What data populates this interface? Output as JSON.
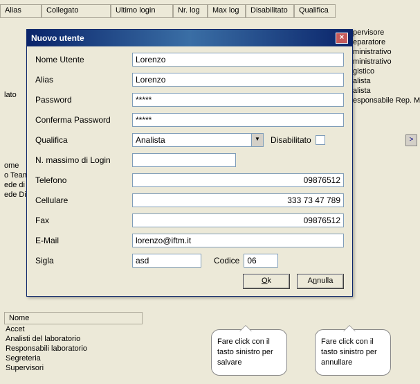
{
  "bg": {
    "headers": [
      "Alias",
      "Collegato",
      "Ultimo login",
      "Nr. log",
      "Max log",
      "Disabilitato",
      "Qualifica"
    ],
    "rightList": [
      "pervisore",
      "eparatore",
      "ministrativo",
      "ministrativo",
      "gistico",
      "alista",
      "alista",
      "esponsabile Rep. M"
    ],
    "leftList": [
      "lato",
      "ome",
      "o Team",
      "ede di R",
      "ede Dista"
    ],
    "bottomHeader": "Nome",
    "bottomList": [
      "Accet",
      "Analisti del laboratorio",
      "Responsabili laboratorio",
      "Segreteria",
      "Supervisori"
    ]
  },
  "dialog": {
    "title": "Nuovo utente",
    "labels": {
      "nome": "Nome Utente",
      "alias": "Alias",
      "password": "Password",
      "conferma": "Conferma Password",
      "qualifica": "Qualifica",
      "disabilitato": "Disabilitato",
      "maxlogin": "N. massimo di Login",
      "telefono": "Telefono",
      "cellulare": "Cellulare",
      "fax": "Fax",
      "email": "E-Mail",
      "sigla": "Sigla",
      "codice": "Codice"
    },
    "values": {
      "nome": "Lorenzo",
      "alias": "Lorenzo",
      "password": "*****",
      "conferma": "*****",
      "qualifica": "Analista",
      "maxlogin": "",
      "telefono": "09876512",
      "cellulare": "333 73 47 789",
      "fax": "09876512",
      "email": "lorenzo@iftm.it",
      "sigla": "asd",
      "codice": "06"
    },
    "buttons": {
      "ok": "Ok",
      "cancel": "Annulla"
    }
  },
  "callouts": {
    "save": "Fare click con il tasto sinistro per salvare",
    "cancel": "Fare click con il tasto sinistro per annullare"
  }
}
